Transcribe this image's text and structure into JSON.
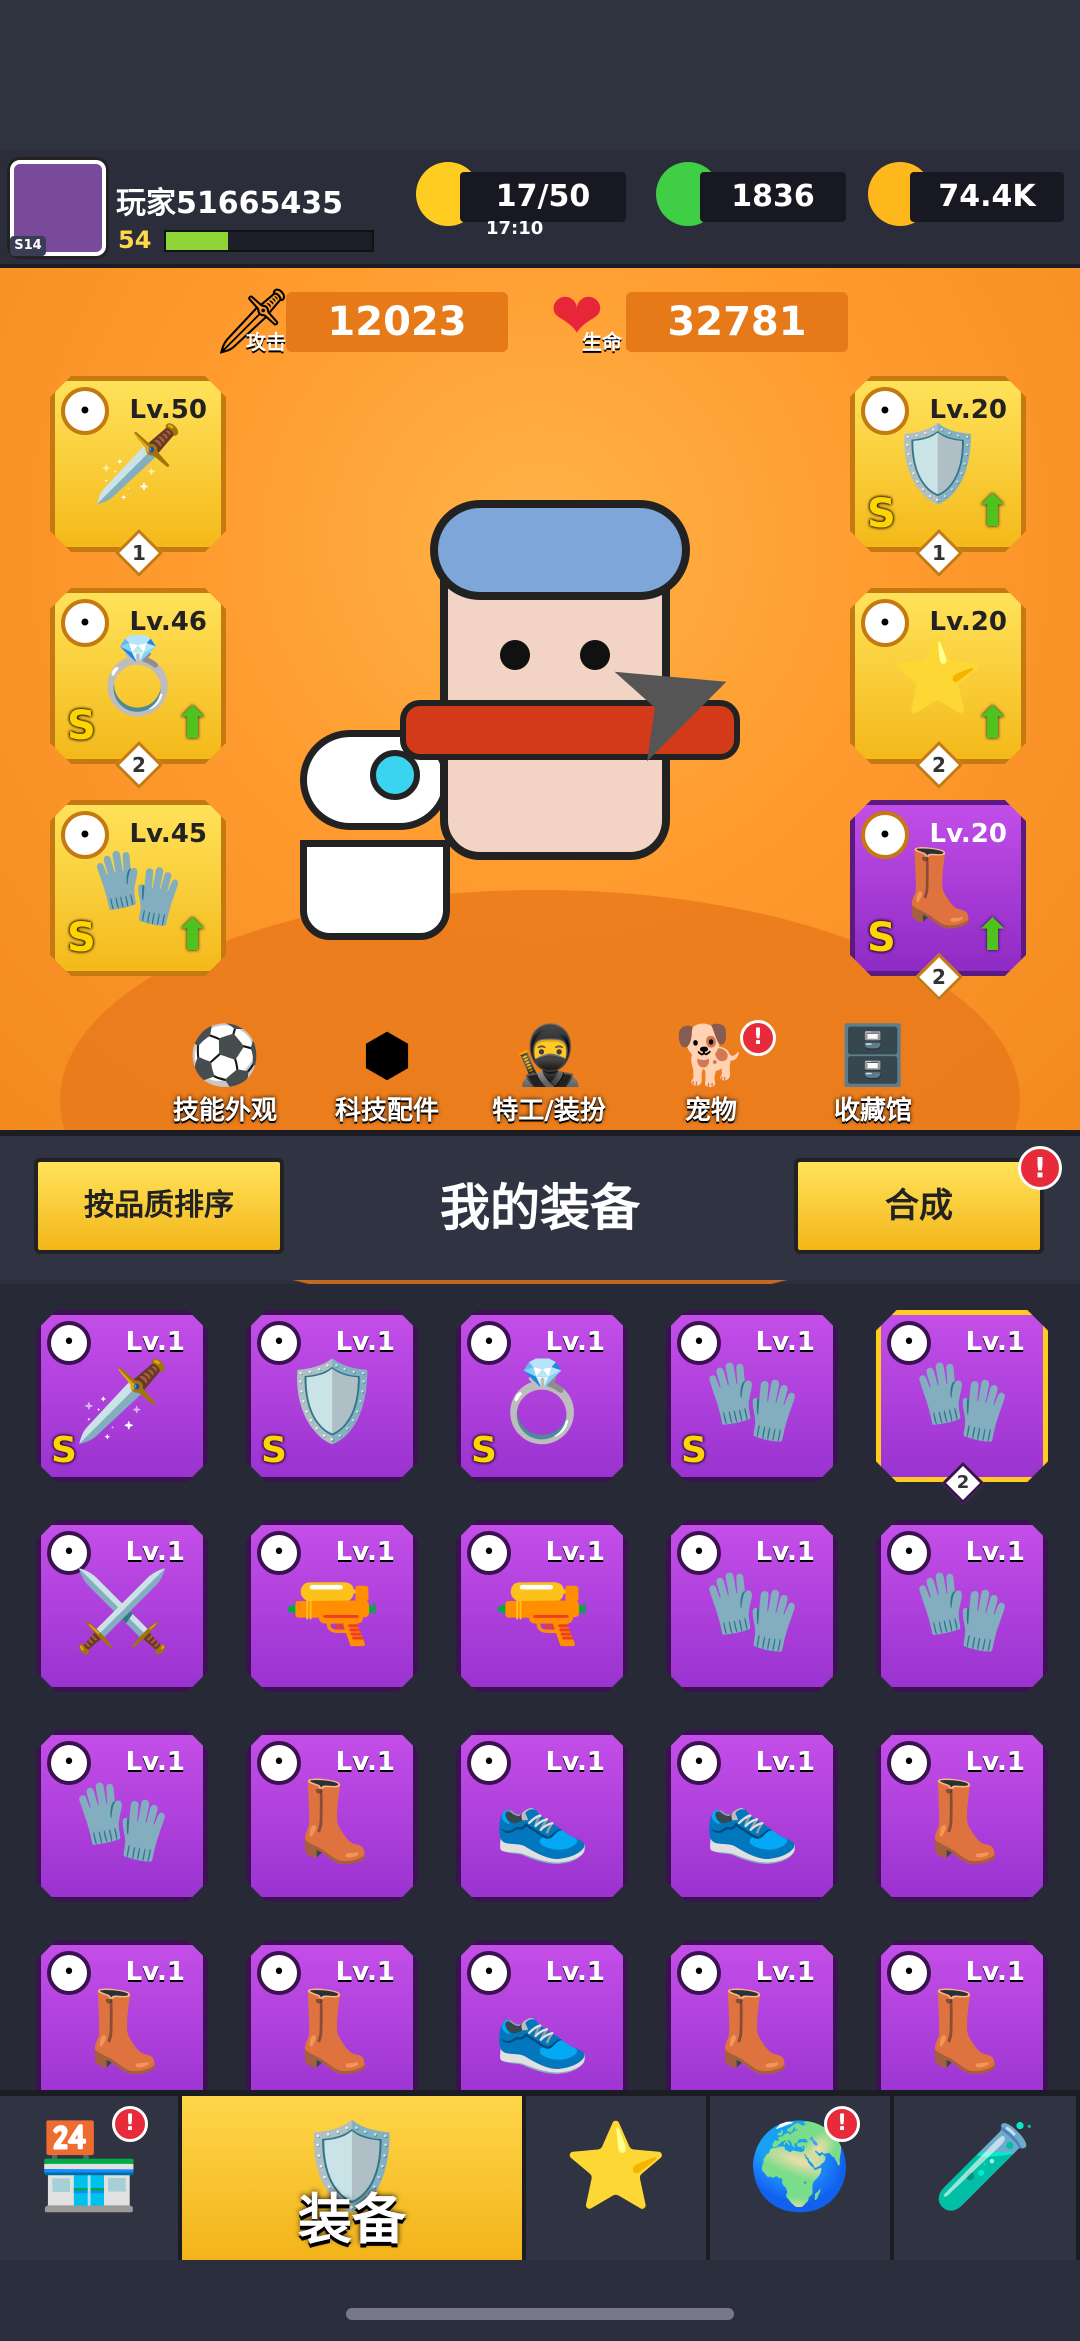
{
  "player": {
    "name": "玩家51665435",
    "level": "54",
    "avatar_badge": "S14",
    "xp_progress": 0.3
  },
  "resources": {
    "energy": "17/50",
    "energy_timer": "17:10",
    "gems": "1836",
    "coins": "74.4K"
  },
  "stats": {
    "attack_value": "12023",
    "attack_label": "攻击",
    "hp_value": "32781",
    "hp_label": "生命"
  },
  "equipped": [
    {
      "slot": "weapon",
      "lv": "Lv.50",
      "num": "1",
      "glyph": "🗡️",
      "type_icon": "blade-icon",
      "s": "",
      "upgrade": false
    },
    {
      "slot": "necklace",
      "lv": "Lv.46",
      "num": "2",
      "glyph": "💍",
      "type_icon": "necklace-icon",
      "s": "S",
      "upgrade": true
    },
    {
      "slot": "gloves",
      "lv": "Lv.45",
      "num": "",
      "glyph": "🧤",
      "type_icon": "glove-icon",
      "s": "S",
      "upgrade": true
    },
    {
      "slot": "armor",
      "lv": "Lv.20",
      "num": "1",
      "glyph": "🛡️",
      "type_icon": "shirt-icon",
      "s": "S",
      "upgrade": true
    },
    {
      "slot": "belt",
      "lv": "Lv.20",
      "num": "2",
      "glyph": "⭐",
      "type_icon": "belt-icon",
      "s": "",
      "upgrade": true
    },
    {
      "slot": "boots",
      "lv": "Lv.20",
      "num": "2",
      "glyph": "👢",
      "type_icon": "boot-icon",
      "s": "S",
      "upgrade": true
    }
  ],
  "features": [
    {
      "label": "技能外观",
      "icon": "⚽",
      "badge": false
    },
    {
      "label": "科技配件",
      "icon": "⬢",
      "badge": false
    },
    {
      "label": "特工/装扮",
      "icon": "🥷",
      "badge": false
    },
    {
      "label": "宠物",
      "icon": "🐕",
      "badge": true
    },
    {
      "label": "收藏馆",
      "icon": "🗄️",
      "badge": false
    }
  ],
  "panel": {
    "sort_label": "按品质排序",
    "title": "我的装备",
    "merge_label": "合成",
    "merge_badge": "!"
  },
  "inventory": [
    {
      "lv": "Lv.1",
      "glyph": "🗡️",
      "s": "S",
      "num": ""
    },
    {
      "lv": "Lv.1",
      "glyph": "🛡️",
      "s": "S",
      "num": ""
    },
    {
      "lv": "Lv.1",
      "glyph": "💍",
      "s": "S",
      "num": ""
    },
    {
      "lv": "Lv.1",
      "glyph": "🧤",
      "s": "S",
      "num": ""
    },
    {
      "lv": "Lv.1",
      "glyph": "🧤",
      "s": "",
      "num": "2"
    },
    {
      "lv": "Lv.1",
      "glyph": "⚔️",
      "s": "",
      "num": ""
    },
    {
      "lv": "Lv.1",
      "glyph": "🔫",
      "s": "",
      "num": ""
    },
    {
      "lv": "Lv.1",
      "glyph": "🔫",
      "s": "",
      "num": ""
    },
    {
      "lv": "Lv.1",
      "glyph": "🧤",
      "s": "",
      "num": ""
    },
    {
      "lv": "Lv.1",
      "glyph": "🧤",
      "s": "",
      "num": ""
    },
    {
      "lv": "Lv.1",
      "glyph": "🧤",
      "s": "",
      "num": ""
    },
    {
      "lv": "Lv.1",
      "glyph": "👢",
      "s": "",
      "num": ""
    },
    {
      "lv": "Lv.1",
      "glyph": "👟",
      "s": "",
      "num": ""
    },
    {
      "lv": "Lv.1",
      "glyph": "👟",
      "s": "",
      "num": ""
    },
    {
      "lv": "Lv.1",
      "glyph": "👢",
      "s": "",
      "num": ""
    },
    {
      "lv": "Lv.1",
      "glyph": "👢",
      "s": "",
      "num": ""
    },
    {
      "lv": "Lv.1",
      "glyph": "👢",
      "s": "",
      "num": ""
    },
    {
      "lv": "Lv.1",
      "glyph": "👟",
      "s": "",
      "num": ""
    },
    {
      "lv": "Lv.1",
      "glyph": "👢",
      "s": "",
      "num": ""
    },
    {
      "lv": "Lv.1",
      "glyph": "👢",
      "s": "",
      "num": ""
    }
  ],
  "nav": [
    {
      "label": "",
      "icon": "🏪",
      "badge": true,
      "active": false
    },
    {
      "label": "装备",
      "icon": "🛡️",
      "badge": false,
      "active": true
    },
    {
      "label": "",
      "icon": "⭐",
      "badge": false,
      "active": false
    },
    {
      "label": "",
      "icon": "🌍",
      "badge": true,
      "active": false
    },
    {
      "label": "",
      "icon": "🧪",
      "badge": false,
      "active": false
    }
  ]
}
